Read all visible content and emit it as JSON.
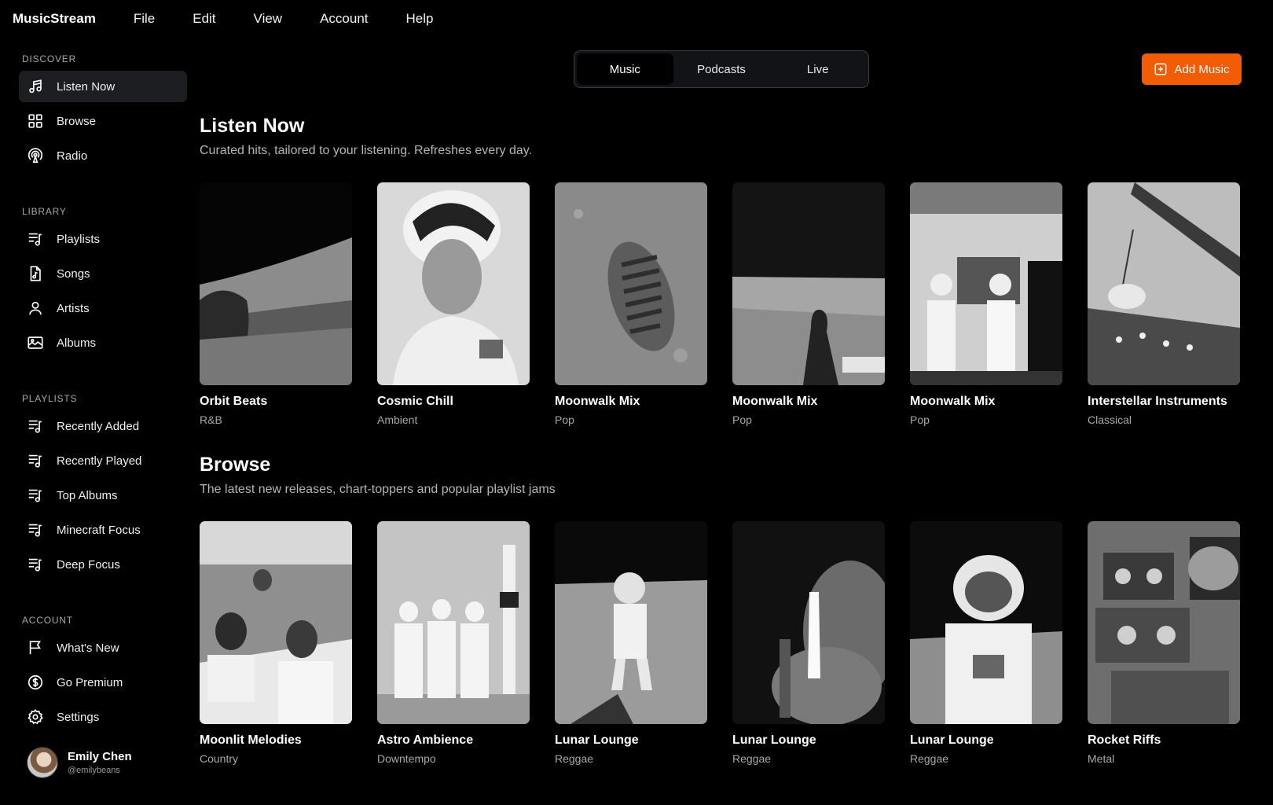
{
  "app": {
    "brand": "MusicStream",
    "menu": [
      "File",
      "Edit",
      "View",
      "Account",
      "Help"
    ]
  },
  "sidebar": {
    "sections": [
      {
        "title": "Discover",
        "items": [
          {
            "label": "Listen Now",
            "icon": "music-note-icon",
            "active": true
          },
          {
            "label": "Browse",
            "icon": "grid-icon"
          },
          {
            "label": "Radio",
            "icon": "radio-icon"
          }
        ]
      },
      {
        "title": "Library",
        "items": [
          {
            "label": "Playlists",
            "icon": "playlist-icon"
          },
          {
            "label": "Songs",
            "icon": "music-file-icon"
          },
          {
            "label": "Artists",
            "icon": "user-icon"
          },
          {
            "label": "Albums",
            "icon": "album-icon"
          }
        ]
      },
      {
        "title": "Playlists",
        "items": [
          {
            "label": "Recently Added",
            "icon": "playlist-icon"
          },
          {
            "label": "Recently Played",
            "icon": "playlist-icon"
          },
          {
            "label": "Top Albums",
            "icon": "playlist-icon"
          },
          {
            "label": "Minecraft Focus",
            "icon": "playlist-icon"
          },
          {
            "label": "Deep Focus",
            "icon": "playlist-icon"
          }
        ]
      },
      {
        "title": "Account",
        "items": [
          {
            "label": "What's New",
            "icon": "flag-icon"
          },
          {
            "label": "Go Premium",
            "icon": "dollar-coin-icon"
          },
          {
            "label": "Settings",
            "icon": "gear-icon"
          }
        ]
      }
    ],
    "profile": {
      "name": "Emily Chen",
      "handle": "@emilybeans"
    }
  },
  "tabs": [
    {
      "label": "Music",
      "active": true
    },
    {
      "label": "Podcasts"
    },
    {
      "label": "Live"
    }
  ],
  "add_button": {
    "label": "Add Music"
  },
  "listen_now": {
    "title": "Listen Now",
    "subtitle": "Curated hits, tailored to your listening. Refreshes every day.",
    "cards": [
      {
        "title": "Orbit Beats",
        "genre": "R&B"
      },
      {
        "title": "Cosmic Chill",
        "genre": "Ambient"
      },
      {
        "title": "Moonwalk Mix",
        "genre": "Pop"
      },
      {
        "title": "Moonwalk Mix",
        "genre": "Pop"
      },
      {
        "title": "Moonwalk Mix",
        "genre": "Pop"
      },
      {
        "title": "Interstellar Instruments",
        "genre": "Classical"
      }
    ]
  },
  "browse": {
    "title": "Browse",
    "subtitle": "The latest new releases, chart-toppers and popular playlist jams",
    "cards": [
      {
        "title": "Moonlit Melodies",
        "genre": "Country"
      },
      {
        "title": "Astro Ambience",
        "genre": "Downtempo"
      },
      {
        "title": "Lunar Lounge",
        "genre": "Reggae"
      },
      {
        "title": "Lunar Lounge",
        "genre": "Reggae"
      },
      {
        "title": "Lunar Lounge",
        "genre": "Reggae"
      },
      {
        "title": "Rocket Riffs",
        "genre": "Metal"
      }
    ]
  },
  "colors": {
    "accent": "#f25c05",
    "background": "#000000",
    "active_item": "#1d1e22"
  }
}
